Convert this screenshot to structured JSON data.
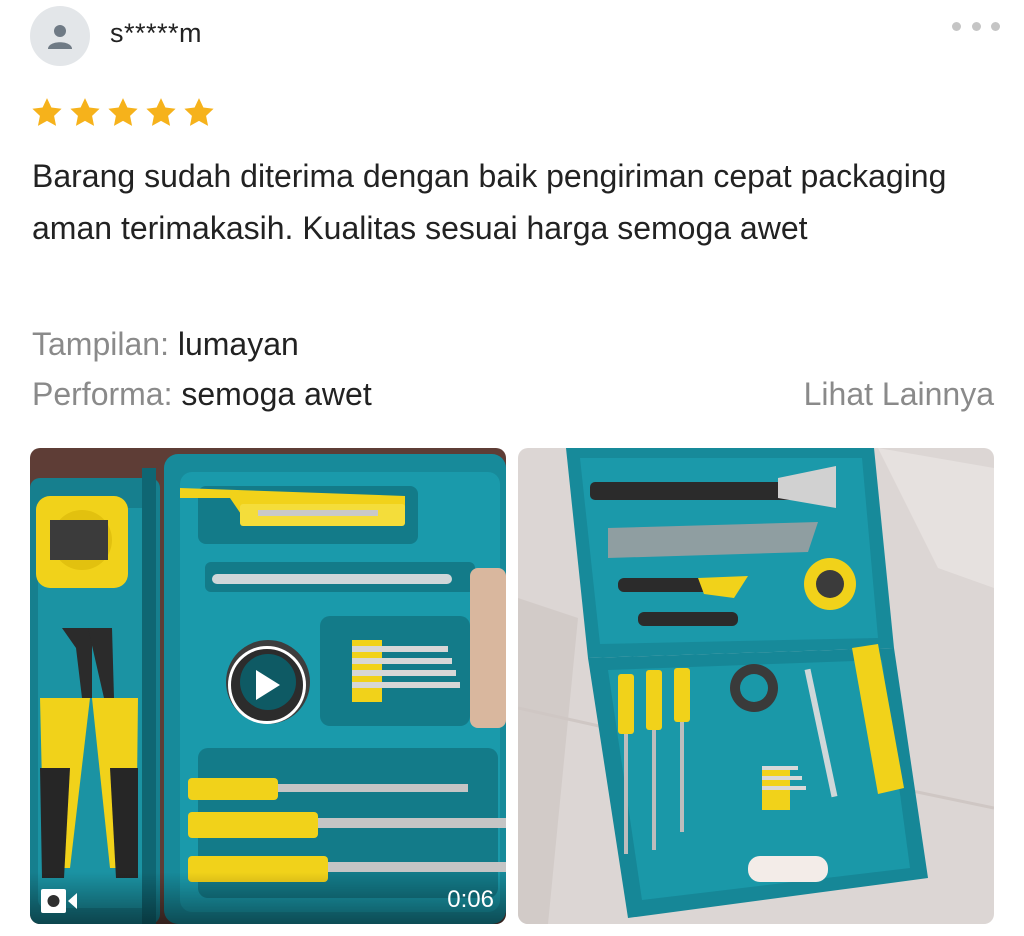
{
  "review": {
    "username": "s*****m",
    "rating": 5,
    "rating_max": 5,
    "star_color": "#F6B21B",
    "text": "Barang sudah diterima dengan baik pengiriman cepat packaging aman terimakasih. Kualitas sesuai harga semoga awet",
    "attributes": [
      {
        "key": "Tampilan:",
        "value": "lumayan"
      },
      {
        "key": "Performa:",
        "value": "semoga awet"
      }
    ],
    "see_more_label": "Lihat Lainnya"
  },
  "media": [
    {
      "type": "video",
      "duration": "0:06",
      "icons": [
        "play-icon",
        "video-camera-icon"
      ]
    },
    {
      "type": "image"
    }
  ],
  "icons": {
    "avatar": "user-icon",
    "menu": "more-horizontal-icon"
  }
}
